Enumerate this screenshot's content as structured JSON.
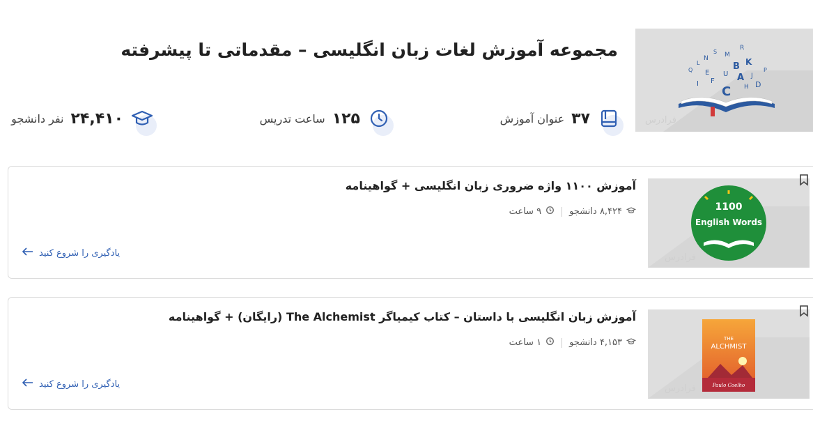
{
  "header": {
    "title": "مجموعه آموزش لغات زبان انگلیسی – مقدماتی تا پیشرفته",
    "image_letters": [
      "N",
      "S",
      "R",
      "Q",
      "L",
      "M",
      "B",
      "K",
      "E",
      "P",
      "I",
      "F",
      "A",
      "U",
      "J",
      "C",
      "H",
      "D"
    ],
    "watermark": "فرادرس"
  },
  "stats": {
    "courses": {
      "value": "۳۷",
      "label": "عنوان آموزش",
      "icon": "book-icon"
    },
    "hours": {
      "value": "۱۲۵",
      "label": "ساعت تدریس",
      "icon": "clock-icon"
    },
    "students": {
      "value": "۲۴,۴۱۰",
      "label": "نفر دانشجو",
      "icon": "graduation-cap-icon"
    }
  },
  "courses": [
    {
      "title": "آموزش ۱۱۰۰ واژه ضروری زبان انگلیسی + گواهینامه",
      "students": "۸,۴۲۴ دانشجو",
      "hours": "۹ ساعت",
      "cta": "یادگیری را شروع کنید",
      "thumb_text_1": "1100",
      "thumb_text_2": "English Words",
      "watermark": "فرادرس"
    },
    {
      "title": "آموزش زبان انگلیسی با داستان – کتاب کیمیاگر The Alchemist (رایگان) + گواهینامه",
      "students": "۴,۱۵۳ دانشجو",
      "hours": "۱ ساعت",
      "cta": "یادگیری را شروع کنید",
      "thumb_text_1": "THE",
      "thumb_text_2": "ALCHMIST",
      "thumb_text_3": "Paulo Coelho",
      "watermark": "فرادرس"
    }
  ],
  "colors": {
    "accent": "#2f5fb3",
    "icon_bg": "#e9eef9",
    "thumb_bg": "#dedede",
    "green": "#1f8f3a",
    "orange": "#f08a2a"
  }
}
